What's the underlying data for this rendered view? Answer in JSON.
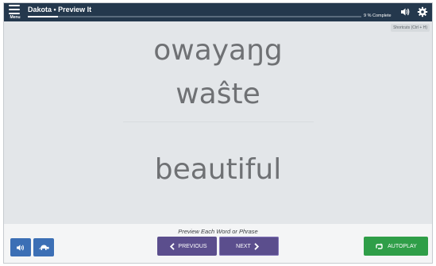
{
  "header": {
    "menu_label": "Menu",
    "title": "Dakota • Preview It",
    "progress_percent": 9,
    "progress_text": "9 % Complete",
    "icons": [
      "volume-icon",
      "gear-icon"
    ]
  },
  "content": {
    "shortcuts_label": "Shortcuts (Ctrl + H)",
    "word_line_1": "owayaŋg",
    "word_line_2": "waŝte",
    "translation": "beautiful"
  },
  "footer": {
    "instruction": "Preview Each Word or Phrase",
    "previous_label": "PREVIOUS",
    "next_label": "NEXT",
    "autoplay_label": "AUTOPLAY",
    "icons": [
      "speaker-icon",
      "turtle-icon"
    ]
  },
  "colors": {
    "top_bar": "#24384d",
    "content_bg": "#e3e6e9",
    "nav_button": "#5b4e8d",
    "audio_button": "#3c6fb5",
    "autoplay_button": "#2f9e48"
  }
}
